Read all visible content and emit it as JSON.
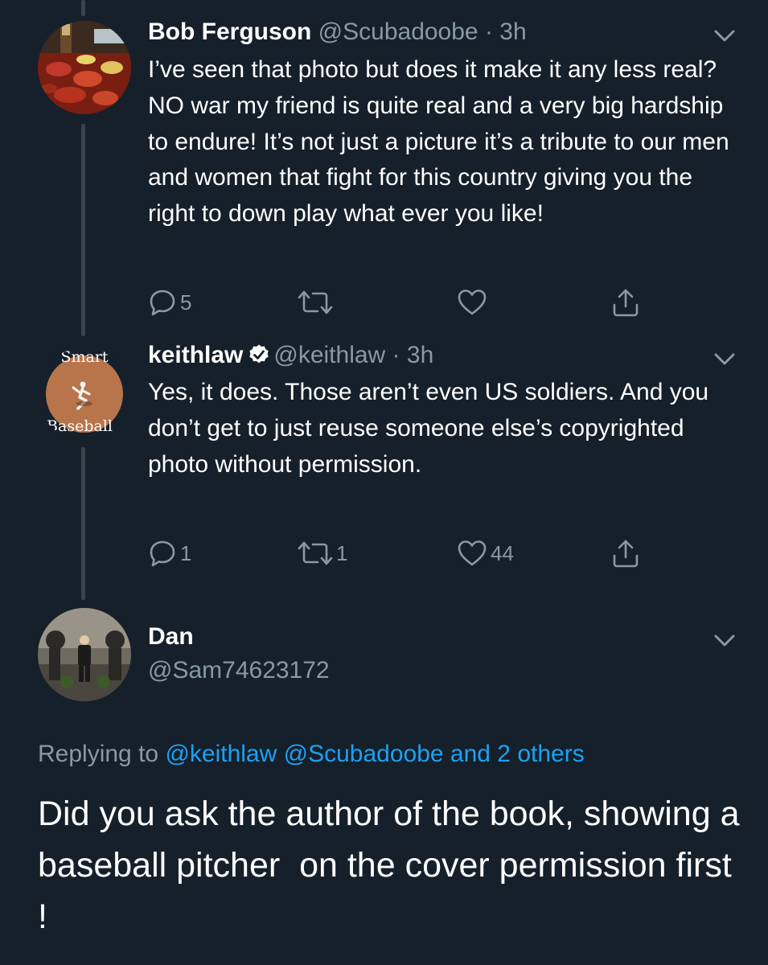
{
  "tweets": [
    {
      "name": "Bob Ferguson",
      "handle": "@Scubadoobe",
      "time": "3h",
      "text": "I’ve seen that photo but does it make it any less real? NO war my friend is quite real and a very big hardship to endure! It’s not just a picture it’s a tribute to our men and women that fight for this country giving you the right to down play what ever you like!",
      "replies": "5",
      "retweets": "",
      "likes": "",
      "avatar_icon": "crawfish-boil-photo"
    },
    {
      "name": "keithlaw",
      "handle": "@keithlaw",
      "time": "3h",
      "verified": true,
      "text": "Yes, it does. Those aren’t even US soldiers. And you don’t get to just reuse someone else’s copyrighted photo without permission.",
      "replies": "1",
      "retweets": "1",
      "likes": "44",
      "avatar_icon": "smart-baseball-book-cover",
      "avatar_text_top": "Smart",
      "avatar_text_bottom": "Baseball"
    }
  ],
  "focused": {
    "name": "Dan",
    "handle": "@Sam74623172",
    "avatar_icon": "man-standing-photo",
    "replying_label": "Replying to",
    "replying_to": [
      "@keithlaw",
      "@Scubadoobe"
    ],
    "others": "and 2 others",
    "text": "Did you ask the author of the book, showing a baseball pitcher  on the cover permission first !"
  },
  "colors": {
    "background": "#15202b",
    "secondary_text": "#8899a6",
    "link": "#1da1f2",
    "thread_line": "#38444d"
  }
}
